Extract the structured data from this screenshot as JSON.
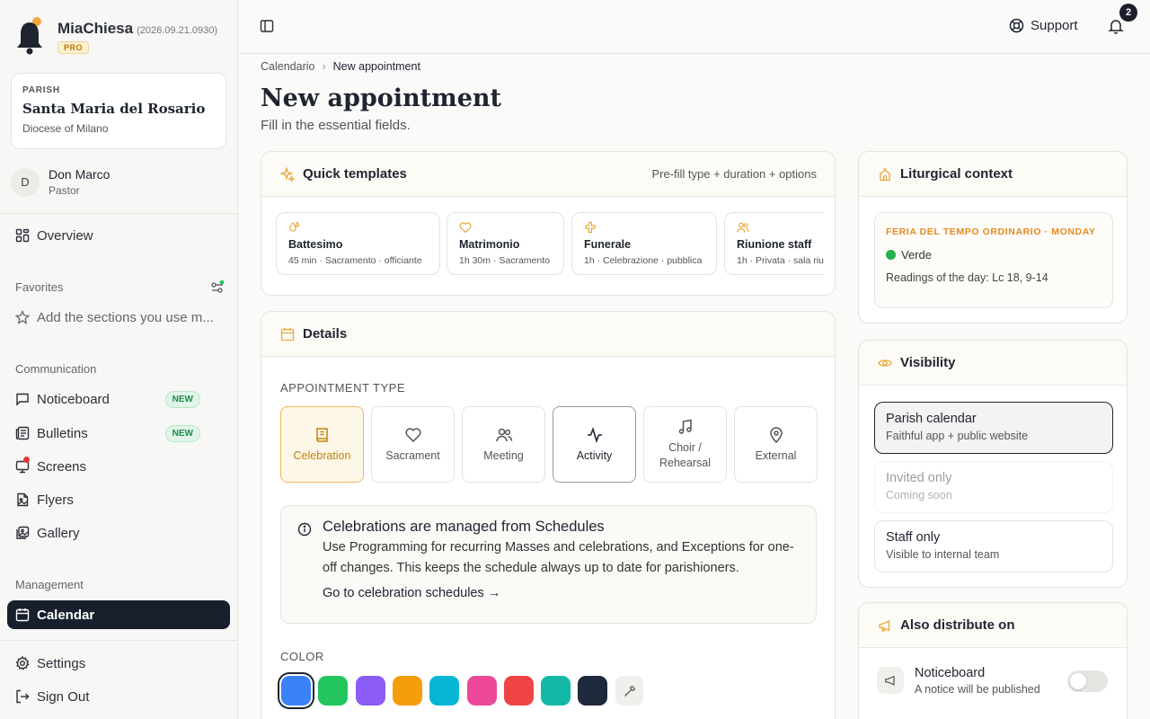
{
  "app": {
    "name": "MiaChiesa",
    "version": "(2026.09.21.0930)",
    "plan_badge": "PRO"
  },
  "parish": {
    "label": "PARISH",
    "name": "Santa Maria del Rosario",
    "diocese": "Diocese of Milano"
  },
  "user": {
    "initial": "D",
    "name": "Don Marco",
    "role": "Pastor"
  },
  "sidebar": {
    "overview": "Overview",
    "favorites_label": "Favorites",
    "favorites_add": "Add the sections you use m...",
    "communication_label": "Communication",
    "communication_items": [
      {
        "label": "Noticeboard",
        "badge": "NEW"
      },
      {
        "label": "Bulletins",
        "badge": "NEW"
      },
      {
        "label": "Screens"
      },
      {
        "label": "Flyers"
      },
      {
        "label": "Gallery"
      }
    ],
    "management_label": "Management",
    "calendar": "Calendar",
    "settings": "Settings",
    "sign_out": "Sign Out"
  },
  "topbar": {
    "support": "Support",
    "notifications_count": "2"
  },
  "breadcrumb": {
    "parent": "Calendario",
    "current": "New appointment"
  },
  "page": {
    "title": "New appointment",
    "subtitle": "Fill in the essential fields."
  },
  "templates": {
    "title": "Quick templates",
    "hint": "Pre-fill type + duration + options",
    "items": [
      {
        "name": "Battesimo",
        "desc": "45 min · Sacramento · officiante",
        "icon": "baptism-icon"
      },
      {
        "name": "Matrimonio",
        "desc": "1h 30m · Sacramento",
        "icon": "heart-icon"
      },
      {
        "name": "Funerale",
        "desc": "1h · Celebrazione · pubblica",
        "icon": "cross-icon"
      },
      {
        "name": "Riunione staff",
        "desc": "1h · Privata · sala riu",
        "icon": "users-icon"
      }
    ]
  },
  "details": {
    "title": "Details",
    "type_label": "APPOINTMENT TYPE",
    "types": [
      {
        "label": "Celebration",
        "icon": "book-icon"
      },
      {
        "label": "Sacrament",
        "icon": "heart-icon"
      },
      {
        "label": "Meeting",
        "icon": "users-icon"
      },
      {
        "label": "Activity",
        "icon": "activity-icon"
      },
      {
        "label": "Choir / Rehearsal",
        "icon": "music-icon"
      },
      {
        "label": "External",
        "icon": "map-pin-icon"
      }
    ],
    "info": {
      "title": "Celebrations are managed from Schedules",
      "text": "Use Programming for recurring Masses and celebrations, and Exceptions for one-off changes. This keeps the schedule always up to date for parishioners.",
      "link": "Go to celebration schedules →"
    },
    "color_label": "COLOR",
    "colors": [
      "#3b82f6",
      "#22c55e",
      "#8b5cf6",
      "#f59e0b",
      "#06b6d4",
      "#ec4899",
      "#ef4444",
      "#14b8a6",
      "#1e293b"
    ]
  },
  "liturgical": {
    "title": "Liturgical context",
    "season": "FERIA DEL TEMPO ORDINARIO · MONDAY",
    "color_name": "Verde",
    "readings": "Readings of the day: Lc 18, 9-14"
  },
  "visibility": {
    "title": "Visibility",
    "options": [
      {
        "title": "Parish calendar",
        "sub": "Faithful app + public website"
      },
      {
        "title": "Invited only",
        "sub": "Coming soon"
      },
      {
        "title": "Staff only",
        "sub": "Visible to internal team"
      }
    ]
  },
  "distribute": {
    "title": "Also distribute on",
    "item_title": "Noticeboard",
    "item_sub": "A notice will be published"
  },
  "colors": {
    "accent": "#e8b85a",
    "sidebar_active": "#18202e"
  }
}
